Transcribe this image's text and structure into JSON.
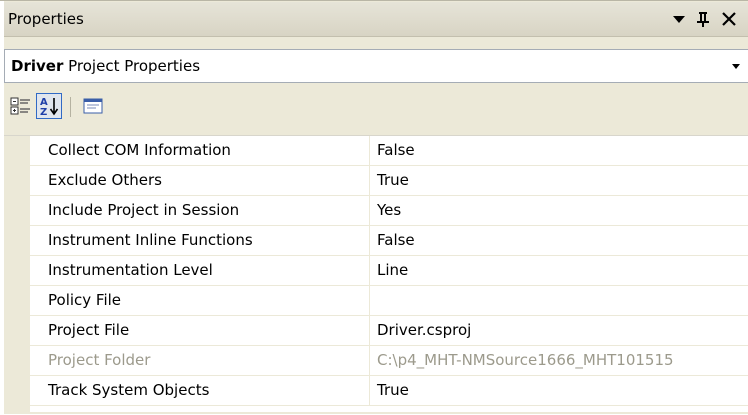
{
  "panel": {
    "title": "Properties",
    "dropdown_glyph": "▼",
    "pin_glyph": "ᚆ",
    "close_glyph": "✕"
  },
  "selector": {
    "object_name": "Driver",
    "object_type": "Project Properties",
    "dropdown_glyph": "▼"
  },
  "toolbar": {
    "icons": [
      "categorized-icon",
      "alphabetical-icon",
      "property-pages-icon"
    ],
    "alphabetical_active": true
  },
  "properties": [
    {
      "name": "Collect COM Information",
      "value": "False",
      "disabled": false
    },
    {
      "name": "Exclude Others",
      "value": "True",
      "disabled": false
    },
    {
      "name": "Include Project in Session",
      "value": "Yes",
      "disabled": false
    },
    {
      "name": "Instrument Inline Functions",
      "value": "False",
      "disabled": false
    },
    {
      "name": "Instrumentation Level",
      "value": "Line",
      "disabled": false
    },
    {
      "name": "Policy File",
      "value": "",
      "disabled": false
    },
    {
      "name": "Project File",
      "value": "Driver.csproj",
      "disabled": false
    },
    {
      "name": "Project Folder",
      "value": "C:\\p4_MHT-NMSource1666_MHT101515",
      "disabled": true
    },
    {
      "name": "Track System Objects",
      "value": "True",
      "disabled": false
    }
  ],
  "colors": {
    "panel_bg": "#ece9d8",
    "selected_border": "#316ac5",
    "disabled_text": "#9c9a8c"
  }
}
